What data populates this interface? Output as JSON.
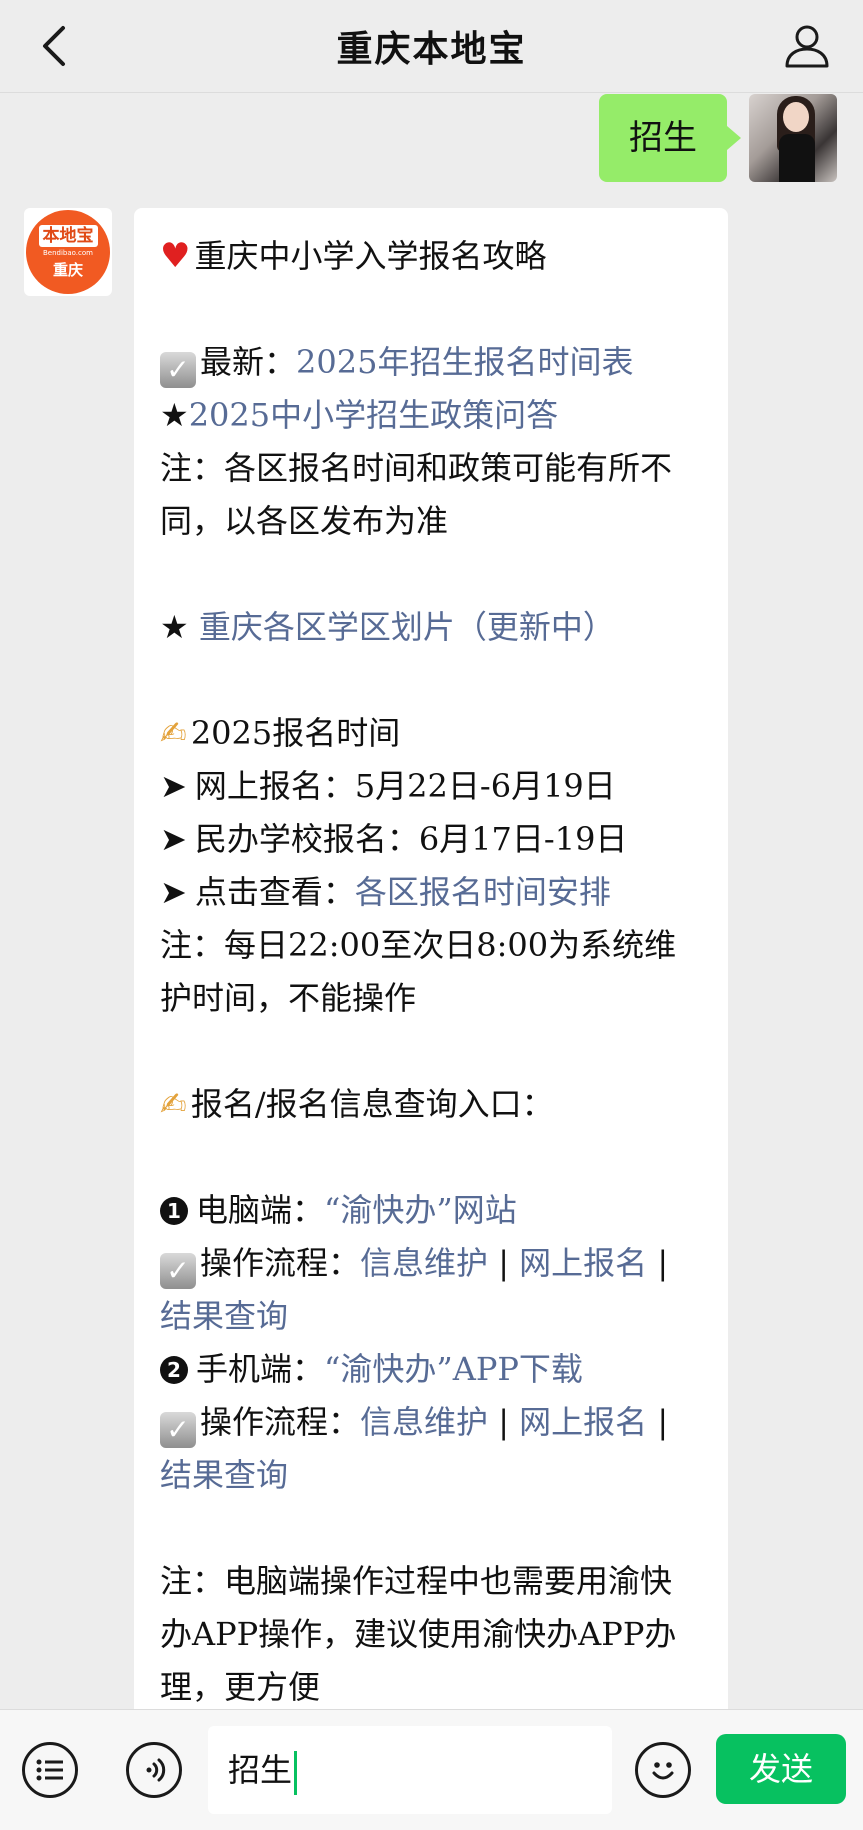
{
  "header": {
    "title": "重庆本地宝",
    "back_icon": "chevron-left-icon",
    "profile_icon": "person-icon"
  },
  "outgoing": {
    "text": "招生"
  },
  "bot_avatar": {
    "logo_text": "本地宝",
    "logo_sub": "Bendibao.com",
    "logo_city": "重庆"
  },
  "message": {
    "title": "重庆中小学入学报名攻略",
    "latest_label": "最新：",
    "latest_link": "2025年招生报名时间表",
    "policy_link": "2025中小学招生政策问答",
    "note1": "注：各区报名时间和政策可能有所不同，以各区发布为准",
    "district_link": "重庆各区学区划片（更新中）",
    "schedule_heading": "2025报名时间",
    "online_signup": "网上报名：5月22日-6月19日",
    "private_signup": "民办学校报名：6月17日-19日",
    "click_view_label": "点击查看：",
    "click_view_link": "各区报名时间安排",
    "note2": "注：每日22:00至次日8:00为系统维护时间，不能操作",
    "entry_heading": "报名/报名信息查询入口：",
    "pc_label": "电脑端：",
    "pc_link": "“渝快办”网站",
    "process_label": "操作流程：",
    "link_info": "信息维护",
    "separator": "|",
    "link_online": "网上报名",
    "link_result": "结果查询",
    "mobile_label": "手机端：",
    "mobile_link": "“渝快办”APP下载",
    "note3": "注：电脑端操作过程中也需要用渝快办APP操作，建议使用渝快办APP办理，更方便"
  },
  "input": {
    "value": "招生",
    "send_label": "发送"
  },
  "colors": {
    "link": "#576b95",
    "outgoing_bubble": "#95ec69",
    "send_button": "#07c160",
    "background": "#ededed"
  }
}
